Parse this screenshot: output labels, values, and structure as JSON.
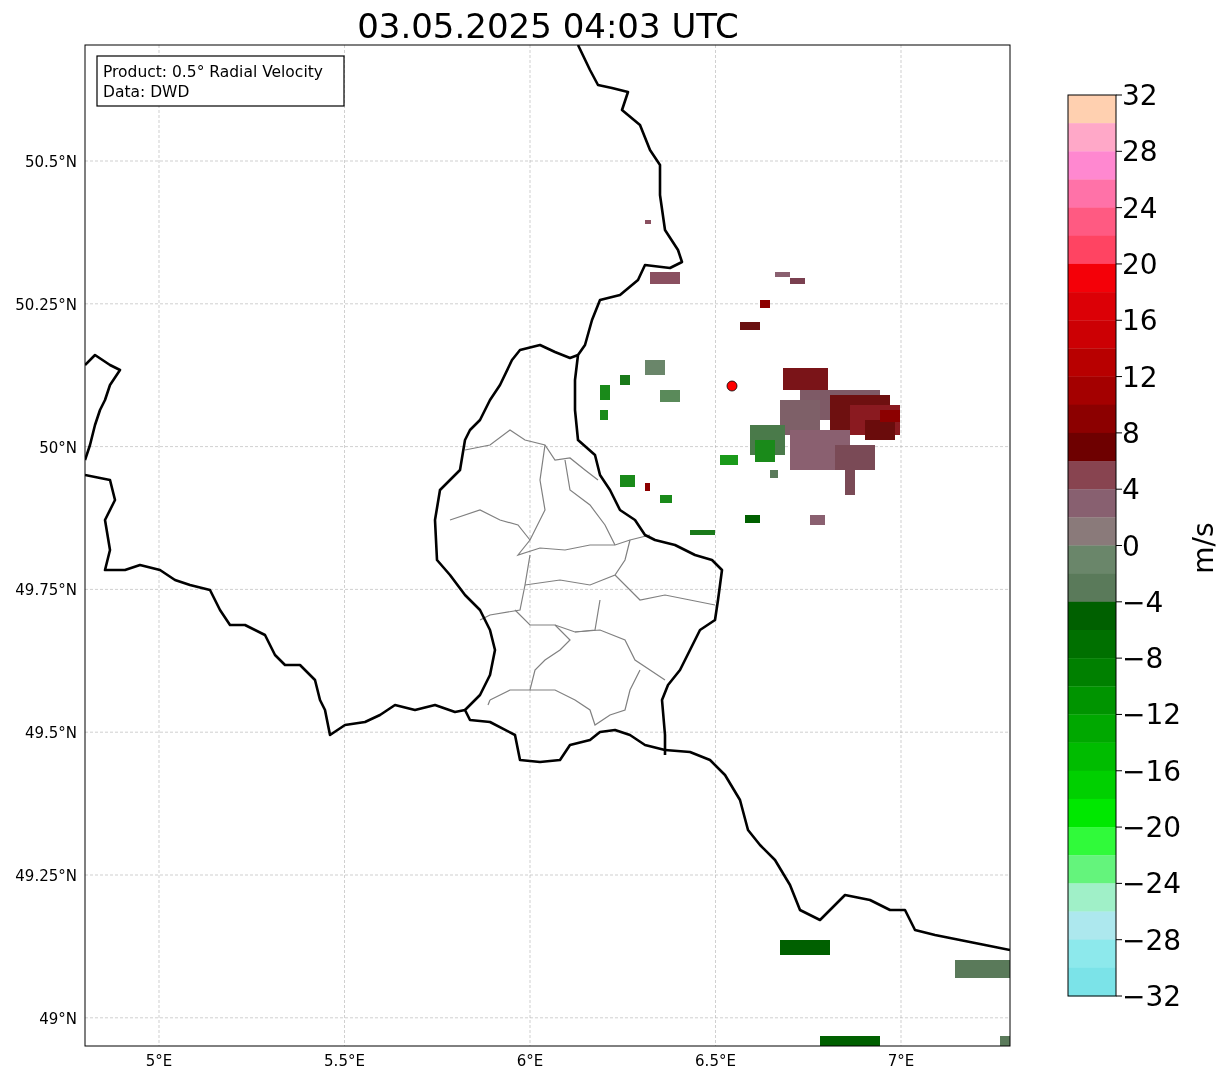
{
  "title": "03.05.2025 04:03 UTC",
  "legend": {
    "lines": [
      "Product: 0.5° Radial Velocity",
      "Data: DWD"
    ]
  },
  "map": {
    "x_ticks": [
      "5°E",
      "5.5°E",
      "6°E",
      "6.5°E",
      "7°E"
    ],
    "y_ticks": [
      "50.5°N",
      "50.25°N",
      "50°N",
      "49.75°N",
      "49.5°N",
      "49.25°N",
      "49°N"
    ]
  },
  "colorbar": {
    "label": "m/s",
    "ticks": [
      "32",
      "28",
      "24",
      "20",
      "16",
      "12",
      "8",
      "4",
      "0",
      "−4",
      "−8",
      "−12",
      "−16",
      "−20",
      "−24",
      "−28",
      "−32"
    ],
    "bins": [
      {
        "color": "#ffd0b0"
      },
      {
        "color": "#ffa8c8"
      },
      {
        "color": "#ff88d0"
      },
      {
        "color": "#ff72a8"
      },
      {
        "color": "#ff5a82"
      },
      {
        "color": "#ff4462"
      },
      {
        "color": "#f40008"
      },
      {
        "color": "#dc0006"
      },
      {
        "color": "#cc0004"
      },
      {
        "color": "#b80000"
      },
      {
        "color": "#a40000"
      },
      {
        "color": "#8c0000"
      },
      {
        "color": "#6e0000"
      },
      {
        "color": "#884450"
      },
      {
        "color": "#886070"
      },
      {
        "color": "#8a7a7a"
      },
      {
        "color": "#6a866a"
      },
      {
        "color": "#5a7a5a"
      },
      {
        "color": "#006000"
      },
      {
        "color": "#007000"
      },
      {
        "color": "#008000"
      },
      {
        "color": "#009400"
      },
      {
        "color": "#00a800"
      },
      {
        "color": "#00bc00"
      },
      {
        "color": "#00d000"
      },
      {
        "color": "#00e800"
      },
      {
        "color": "#30fa3a"
      },
      {
        "color": "#64f47c"
      },
      {
        "color": "#a0f0c8"
      },
      {
        "color": "#ade8ee"
      },
      {
        "color": "#8de9ec"
      },
      {
        "color": "#7be3e8"
      }
    ]
  }
}
